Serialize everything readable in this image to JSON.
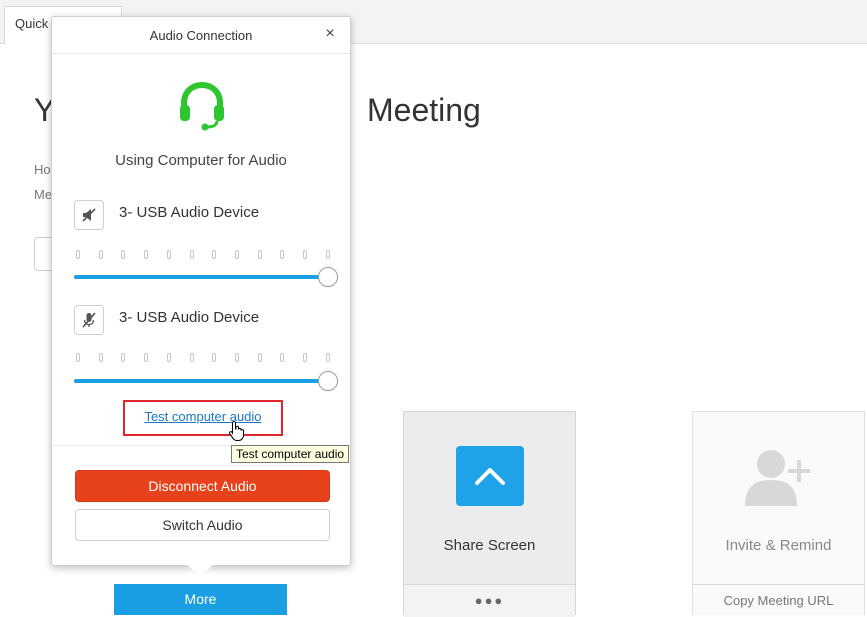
{
  "tab": {
    "label": "Quick"
  },
  "page": {
    "title_left": "Y",
    "title_right": "Meeting",
    "line1": "Ho",
    "line2": "Me"
  },
  "popup": {
    "title": "Audio Connection",
    "close": "×",
    "status": "Using Computer for Audio",
    "speaker": {
      "label": "3- USB Audio Device",
      "level": 1.0
    },
    "microphone": {
      "label": "3- USB Audio Device",
      "level": 1.0
    },
    "test_link": "Test computer audio",
    "disconnect": "Disconnect Audio",
    "switch": "Switch Audio"
  },
  "tooltip": "Test computer audio",
  "cards": {
    "share": {
      "label": "Share Screen",
      "footer": "●●●"
    },
    "invite": {
      "label": "Invite & Remind",
      "footer": "Copy Meeting URL"
    },
    "more": {
      "label": "More"
    }
  },
  "colors": {
    "accent": "#1b9fe4",
    "disconnect": "#e8421d",
    "headset": "#2ec52e",
    "highlight": "#e0262e"
  }
}
